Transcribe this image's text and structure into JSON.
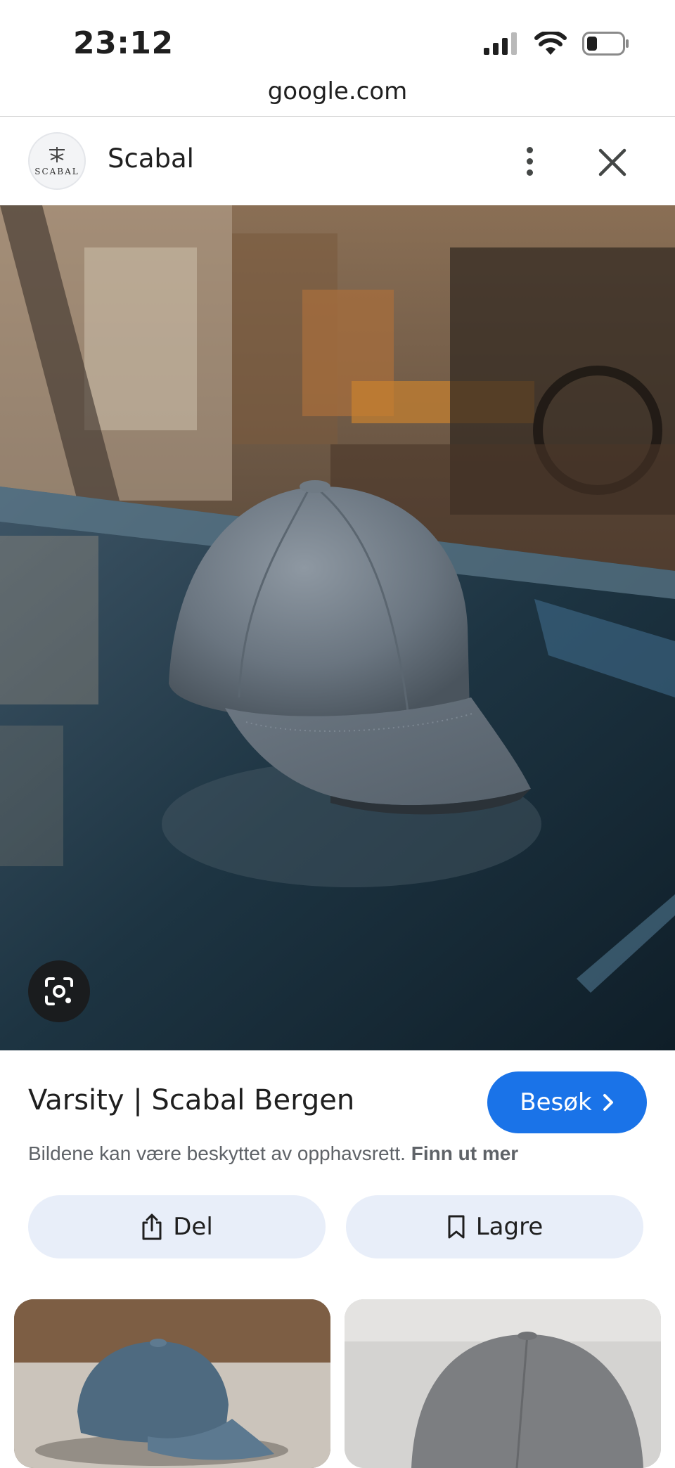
{
  "status_bar": {
    "time": "23:12",
    "icons": [
      "cellular-signal-icon",
      "wifi-icon",
      "battery-icon"
    ]
  },
  "browser": {
    "url": "google.com"
  },
  "source": {
    "name": "Scabal",
    "logo_text": "SCABAL"
  },
  "image": {
    "description_icon": "lens-icon"
  },
  "result": {
    "title": "Varsity | Scabal Bergen",
    "visit_label": "Besøk",
    "copyright_text": "Bildene kan være beskyttet av opphavsrett.",
    "learn_more": "Finn ut mer"
  },
  "actions": {
    "share_label": "Del",
    "save_label": "Lagre"
  },
  "colors": {
    "accent": "#1a73e8",
    "action_bg": "#e8eef9",
    "secondary_text": "#5f6368"
  }
}
